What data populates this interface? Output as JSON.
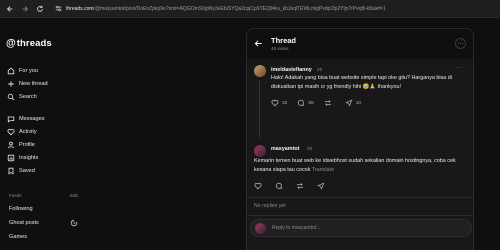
{
  "browser": {
    "url_host": "threads.com",
    "url_path": "/@masyamtot/post/DoEnZpkp9e?xmt=AQGOmS0gWy3eEfaSYQa2cpjCp9TE2j94ru_kbJoqlTEWLmlgPvdp1fp2Yljn7rPvqB-k8alef=1"
  },
  "logo": {
    "text": "threads"
  },
  "sidebar": {
    "items": [
      {
        "label": "For you"
      },
      {
        "label": "New thread"
      },
      {
        "label": "Search"
      },
      {
        "label": "Messages"
      },
      {
        "label": "Activity"
      },
      {
        "label": "Profile"
      },
      {
        "label": "Insights"
      },
      {
        "label": "Saved"
      }
    ],
    "feeds_title": "Feeds",
    "edit_label": "Edit",
    "feeds": [
      "Following",
      "Ghost posts",
      "Games"
    ]
  },
  "thread": {
    "title": "Thread",
    "views": "46 views",
    "post1": {
      "username": "imeldastefianny",
      "time": "2h",
      "text_line1": "Halo! Adakah yang bisa buat website simple tapi oke gitu? Harganya bisa di",
      "text_line2": "diskusikan tpi masih cr yg friendly hihi 🥹🙏 thankyou!",
      "likes": "32",
      "comments": "59",
      "reposts": "",
      "shares": "10"
    },
    "post2": {
      "username": "masyamtot",
      "time": "2h",
      "text_line1": "Kemarin temen buat web ke idwebhost sudah sekalian domain hostingnya, coba cek",
      "text_line2": "kesana siapa tau cocok",
      "translate": "Translate"
    },
    "no_replies": "No replies yet",
    "reply_placeholder": "Reply to masyamtot..."
  }
}
